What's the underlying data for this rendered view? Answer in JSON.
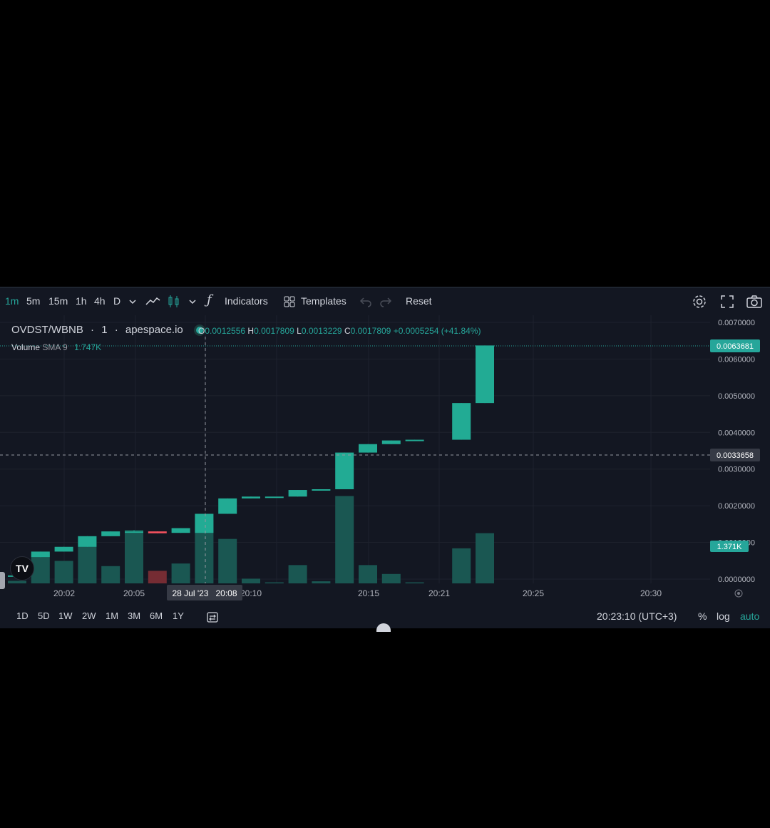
{
  "toolbar": {
    "intervals": [
      "1m",
      "5m",
      "15m",
      "1h",
      "4h",
      "D"
    ],
    "active_interval": "1m",
    "indicators_label": "Indicators",
    "templates_label": "Templates",
    "reset_label": "Reset"
  },
  "legend": {
    "symbol": "OVDST/WBNB",
    "interval": "1",
    "source": "apespace.io",
    "open_label": "O",
    "open": "0.0012556",
    "high_label": "H",
    "high": "0.0017809",
    "low_label": "L",
    "low": "0.0013229",
    "close_label": "C",
    "close": "0.0017809",
    "change": "+0.0005254 (+41.84%)",
    "volume_label": "Volume",
    "volume_sma": "SMA 9",
    "volume_value": "1.747K"
  },
  "price_axis": {
    "labels": [
      "0.0070000",
      "0.0060000",
      "0.0050000",
      "0.0040000",
      "0.0030000",
      "0.0020000",
      "0.0010000",
      "0.0000000"
    ],
    "last_price": "0.0063681",
    "crosshair_price": "0.0033658",
    "volume_tag": "1.371K"
  },
  "time_axis": {
    "labels": [
      "20:02",
      "20:05",
      "20:10",
      "20:15",
      "20:21",
      "20:25",
      "20:30"
    ],
    "crosshair_label": "28 Jul '23   20:08"
  },
  "chart_data": {
    "type": "candlestick",
    "y_range": [
      0,
      0.007
    ],
    "candles": [
      {
        "t": "20:00",
        "o": 0.0001,
        "c": 0.0001,
        "h": 0.0001,
        "l": 0.0001
      },
      {
        "t": "20:01",
        "o": 0.0006,
        "c": 0.00075,
        "h": 0.00075,
        "l": 0.0006
      },
      {
        "t": "20:02",
        "o": 0.00075,
        "c": 0.00088,
        "h": 0.00088,
        "l": 0.00075
      },
      {
        "t": "20:03",
        "o": 0.00088,
        "c": 0.00117,
        "h": 0.00117,
        "l": 0.00088
      },
      {
        "t": "20:04",
        "o": 0.00117,
        "c": 0.0013,
        "h": 0.0013,
        "l": 0.00117
      },
      {
        "t": "20:05",
        "o": 0.0013,
        "c": 0.0013,
        "h": 0.00133,
        "l": 0.0013
      },
      {
        "t": "20:06",
        "o": 0.0013,
        "c": 0.00125,
        "h": 0.0013,
        "l": 0.00125
      },
      {
        "t": "20:07",
        "o": 0.00126,
        "c": 0.00139,
        "h": 0.00139,
        "l": 0.00126
      },
      {
        "t": "20:08",
        "o": 0.00126,
        "c": 0.00178,
        "h": 0.00178,
        "l": 0.00126
      },
      {
        "t": "20:09",
        "o": 0.00178,
        "c": 0.0022,
        "h": 0.0022,
        "l": 0.00178
      },
      {
        "t": "20:10",
        "o": 0.0022,
        "c": 0.00225,
        "h": 0.00225,
        "l": 0.0022
      },
      {
        "t": "20:11",
        "o": 0.00225,
        "c": 0.00225,
        "h": 0.00225,
        "l": 0.00225
      },
      {
        "t": "20:12",
        "o": 0.00225,
        "c": 0.00243,
        "h": 0.00243,
        "l": 0.00225
      },
      {
        "t": "20:13",
        "o": 0.00243,
        "c": 0.00245,
        "h": 0.00245,
        "l": 0.00243
      },
      {
        "t": "20:14",
        "o": 0.00245,
        "c": 0.00345,
        "h": 0.00345,
        "l": 0.00245
      },
      {
        "t": "20:15",
        "o": 0.00345,
        "c": 0.00368,
        "h": 0.00368,
        "l": 0.00345
      },
      {
        "t": "20:16",
        "o": 0.00368,
        "c": 0.00378,
        "h": 0.00378,
        "l": 0.00368
      },
      {
        "t": "20:17",
        "o": 0.00378,
        "c": 0.0038,
        "h": 0.0038,
        "l": 0.00378
      },
      {
        "t": "20:19",
        "o": 0.0038,
        "c": 0.0048,
        "h": 0.0048,
        "l": 0.0038
      },
      {
        "t": "20:20",
        "o": 0.0048,
        "c": 0.00637,
        "h": 0.00637,
        "l": 0.0048
      }
    ],
    "volume_range": [
      0,
      1500
    ],
    "volumes": [
      50,
      580,
      430,
      900,
      330,
      1020,
      240,
      380,
      1210,
      850,
      90,
      20,
      350,
      40,
      1670,
      350,
      180,
      20,
      670,
      960
    ]
  }
}
